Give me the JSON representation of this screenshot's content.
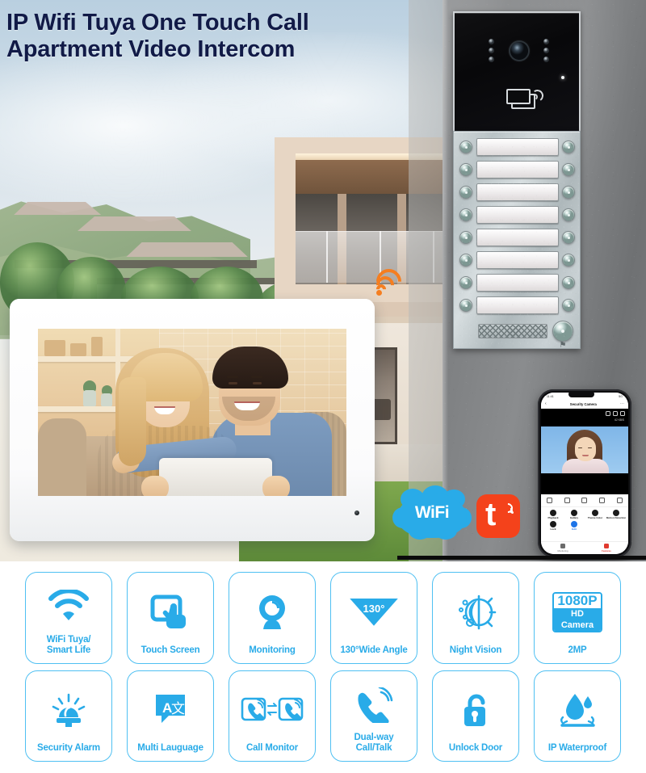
{
  "title": {
    "line1": "IP Wifi Tuya One Touch Call",
    "line2": "Apartment Video Intercom",
    "color": "#111a47"
  },
  "theme": {
    "accent_blue": "#29abe8",
    "card_border": "#4fc0f2",
    "tuya_orange": "#f4421b",
    "wifi_signal_orange": "#f57e20"
  },
  "hero": {
    "door_station": {
      "name": "apartment-door-station",
      "call_button_rows": 8,
      "icons": [
        "camera-lens",
        "ir-led",
        "rfid-card-reader",
        "status-led",
        "speaker-grille",
        "bell-button"
      ]
    },
    "monitor": {
      "name": "indoor-touch-monitor",
      "screen_content": "couple-on-sofa-with-tablet"
    },
    "wifi_signal_icon": "wifi-signal-icon"
  },
  "phone_app": {
    "screen_title": "Security Camera",
    "status_bar": {
      "left": "11:41",
      "right": "5G"
    },
    "stream_rate": "62 KB/S",
    "quick_actions": [
      {
        "label": "Playback",
        "icon": "playback-icon"
      },
      {
        "label": "Gallery",
        "icon": "gallery-icon"
      },
      {
        "label": "Theme Color",
        "icon": "theme-color-icon"
      },
      {
        "label": "Motion Detection",
        "icon": "motion-detection-icon"
      },
      {
        "label": "Lock",
        "icon": "lock-icon"
      },
      {
        "label": "Edit",
        "icon": "edit-icon"
      }
    ],
    "tabs": [
      {
        "label": "Monitoring",
        "icon": "monitoring-icon",
        "active": false
      },
      {
        "label": "Features",
        "icon": "features-icon",
        "active": true
      }
    ]
  },
  "logos": {
    "wifi": {
      "text": "WiFi",
      "name": "wifi-logo"
    },
    "tuya": {
      "text": "t",
      "name": "tuya-logo"
    }
  },
  "features": [
    {
      "label_line1": "WiFi Tuya/",
      "label_line2": "Smart Life",
      "icon": "wifi-icon"
    },
    {
      "label_line1": "Touch Screen",
      "label_line2": "",
      "icon": "touch-screen-icon"
    },
    {
      "label_line1": "Monitoring",
      "label_line2": "",
      "icon": "monitoring-camera-icon"
    },
    {
      "label_line1": "130°Wide Angle",
      "label_line2": "",
      "icon": "wide-angle-icon",
      "icon_text": "130°"
    },
    {
      "label_line1": "Night Vision",
      "label_line2": "",
      "icon": "night-vision-icon"
    },
    {
      "label_line1": "2MP",
      "label_line2": "",
      "icon": "hd-camera-badge-icon",
      "badge_top": "1080P",
      "badge_bottom": "HD Camera"
    },
    {
      "label_line1": "Security Alarm",
      "label_line2": "",
      "icon": "siren-icon"
    },
    {
      "label_line1": "Multi Lauguage",
      "label_line2": "",
      "icon": "multi-language-icon"
    },
    {
      "label_line1": "Call Monitor",
      "label_line2": "",
      "icon": "call-monitor-icon"
    },
    {
      "label_line1": "Dual-way",
      "label_line2": "Call/Talk",
      "icon": "handset-icon"
    },
    {
      "label_line1": "Unlock Door",
      "label_line2": "",
      "icon": "unlock-icon"
    },
    {
      "label_line1": "IP Waterproof",
      "label_line2": "",
      "icon": "waterdrop-icon"
    }
  ]
}
